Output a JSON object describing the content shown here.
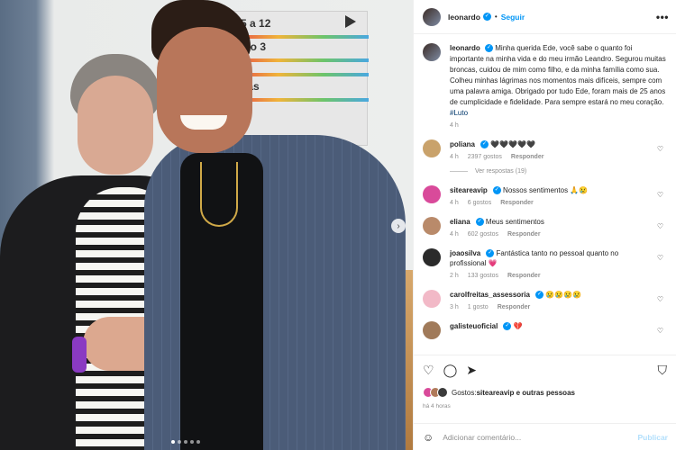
{
  "post": {
    "image_description_hidden": "",
    "sign_lines": [
      "5 a 12",
      "dio 3",
      "bas"
    ]
  },
  "header": {
    "username": "leonardo",
    "follow_label": "Seguir",
    "more_label": "•••"
  },
  "caption": {
    "username": "leonardo",
    "text": "Minha querida Ede, você sabe o quanto foi importante na minha vida e do meu irmão Leandro. Segurou muitas broncas, cuidou de mim como filho, e da minha família como sua. Colheu minhas lágrimas nos momentos mais difíceis, sempre com uma palavra amiga. Obrigado por tudo Ede, foram mais de 25 anos de cumplicidade e fidelidade. Para sempre estará no meu coração.",
    "hashtag": "#Luto",
    "time": "4 h"
  },
  "comments": [
    {
      "username": "poliana",
      "verified": true,
      "text": "🖤🖤🖤🖤🖤",
      "time": "4 h",
      "likes": "2397 gostos",
      "reply": "Responder",
      "avatar_color": "#c9a26b",
      "view_replies": "Ver respostas (19)"
    },
    {
      "username": "siteareavip",
      "verified": true,
      "text": "Nossos sentimentos 🙏😢",
      "time": "4 h",
      "likes": "6 gostos",
      "reply": "Responder",
      "avatar_color": "#d94a9a"
    },
    {
      "username": "eliana",
      "verified": true,
      "text": "Meus sentimentos",
      "time": "4 h",
      "likes": "602 gostos",
      "reply": "Responder",
      "avatar_color": "#b98a6a"
    },
    {
      "username": "joaosilva",
      "verified": true,
      "text": "Fantástica tanto no pessoal quanto no profissional 💗",
      "time": "2 h",
      "likes": "133 gostos",
      "reply": "Responder",
      "avatar_color": "#2b2b2b"
    },
    {
      "username": "carolfreitas_assessoria",
      "verified": true,
      "text": "😢😢😢😢",
      "time": "3 h",
      "likes": "1 gosto",
      "reply": "Responder",
      "avatar_color": "#f2b9c7"
    },
    {
      "username": "galisteuoficial",
      "verified": true,
      "text": "💔",
      "time": "",
      "likes": "",
      "reply": "",
      "avatar_color": "#a07a5a"
    }
  ],
  "likes": {
    "prefix": "Gostos: ",
    "names": "siteareavip e outras pessoas",
    "ago": "há 4 horas"
  },
  "add_comment": {
    "placeholder": "Adicionar comentário...",
    "publish_label": "Publicar"
  },
  "colors": {
    "accent": "#0095f6",
    "muted": "#8e8e8e",
    "text": "#262626"
  }
}
